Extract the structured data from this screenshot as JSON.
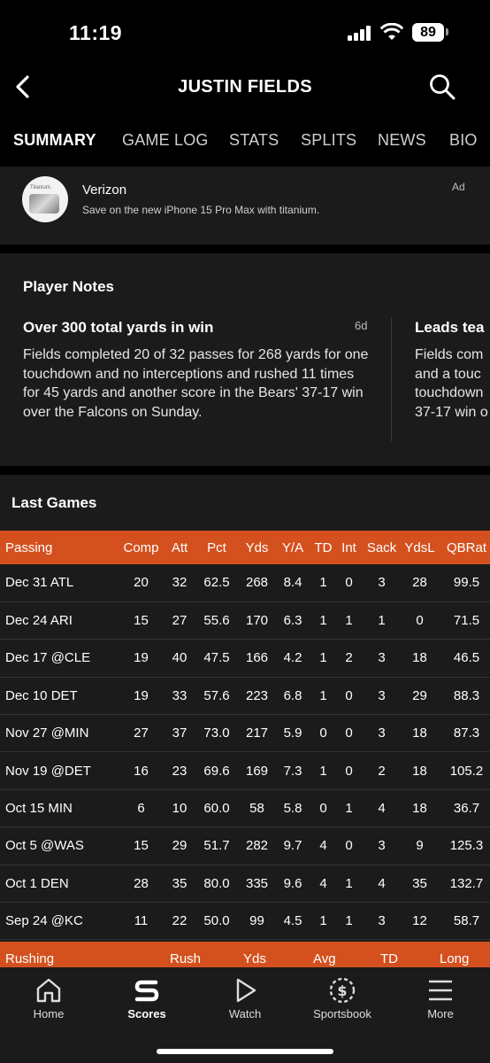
{
  "status_bar": {
    "time": "11:19",
    "battery": "89"
  },
  "header": {
    "title": "JUSTIN FIELDS"
  },
  "tabs": [
    {
      "label": "SUMMARY",
      "active": true
    },
    {
      "label": "GAME LOG"
    },
    {
      "label": "STATS"
    },
    {
      "label": "SPLITS"
    },
    {
      "label": "NEWS"
    },
    {
      "label": "BIO"
    }
  ],
  "ad": {
    "brand": "Verizon",
    "description": "Save on the new iPhone 15 Pro Max with titanium.",
    "tag": "Ad",
    "logo_text": "Titanium."
  },
  "player_notes": {
    "heading": "Player Notes",
    "notes": [
      {
        "title": "Over 300 total yards in win",
        "age": "6d",
        "body": "Fields completed 20 of 32 passes for 268 yards for one touchdown and no interceptions and rushed 11 times for 45 yards and another score in the Bears' 37-17 win over the Falcons on Sunday."
      },
      {
        "title": "Leads tea",
        "body": "Fields com and a touc touchdown 37-17 win o"
      }
    ]
  },
  "last_games": {
    "heading": "Last Games",
    "passing_columns": [
      "Passing",
      "Comp",
      "Att",
      "Pct",
      "Yds",
      "Y/A",
      "TD",
      "Int",
      "Sack",
      "YdsL",
      "QBRat"
    ],
    "passing_rows": [
      [
        "Dec 31 ATL",
        "20",
        "32",
        "62.5",
        "268",
        "8.4",
        "1",
        "0",
        "3",
        "28",
        "99.5"
      ],
      [
        "Dec 24 ARI",
        "15",
        "27",
        "55.6",
        "170",
        "6.3",
        "1",
        "1",
        "1",
        "0",
        "71.5"
      ],
      [
        "Dec 17 @CLE",
        "19",
        "40",
        "47.5",
        "166",
        "4.2",
        "1",
        "2",
        "3",
        "18",
        "46.5"
      ],
      [
        "Dec 10 DET",
        "19",
        "33",
        "57.6",
        "223",
        "6.8",
        "1",
        "0",
        "3",
        "29",
        "88.3"
      ],
      [
        "Nov 27 @MIN",
        "27",
        "37",
        "73.0",
        "217",
        "5.9",
        "0",
        "0",
        "3",
        "18",
        "87.3"
      ],
      [
        "Nov 19 @DET",
        "16",
        "23",
        "69.6",
        "169",
        "7.3",
        "1",
        "0",
        "2",
        "18",
        "105.2"
      ],
      [
        "Oct 15 MIN",
        "6",
        "10",
        "60.0",
        "58",
        "5.8",
        "0",
        "1",
        "4",
        "18",
        "36.7"
      ],
      [
        "Oct 5 @WAS",
        "15",
        "29",
        "51.7",
        "282",
        "9.7",
        "4",
        "0",
        "3",
        "9",
        "125.3"
      ],
      [
        "Oct 1 DEN",
        "28",
        "35",
        "80.0",
        "335",
        "9.6",
        "4",
        "1",
        "4",
        "35",
        "132.7"
      ],
      [
        "Sep 24 @KC",
        "11",
        "22",
        "50.0",
        "99",
        "4.5",
        "1",
        "1",
        "3",
        "12",
        "58.7"
      ]
    ],
    "rushing_columns": [
      "Rushing",
      "Rush",
      "Yds",
      "Avg",
      "TD",
      "Long"
    ]
  },
  "bottom_nav": [
    {
      "label": "Home",
      "icon": "home-icon"
    },
    {
      "label": "Scores",
      "icon": "scores-icon",
      "active": true
    },
    {
      "label": "Watch",
      "icon": "play-icon"
    },
    {
      "label": "Sportsbook",
      "icon": "sportsbook-icon"
    },
    {
      "label": "More",
      "icon": "menu-icon"
    }
  ],
  "colors": {
    "accent": "#d4511f",
    "card": "#1b1b1b",
    "background": "#000000"
  }
}
